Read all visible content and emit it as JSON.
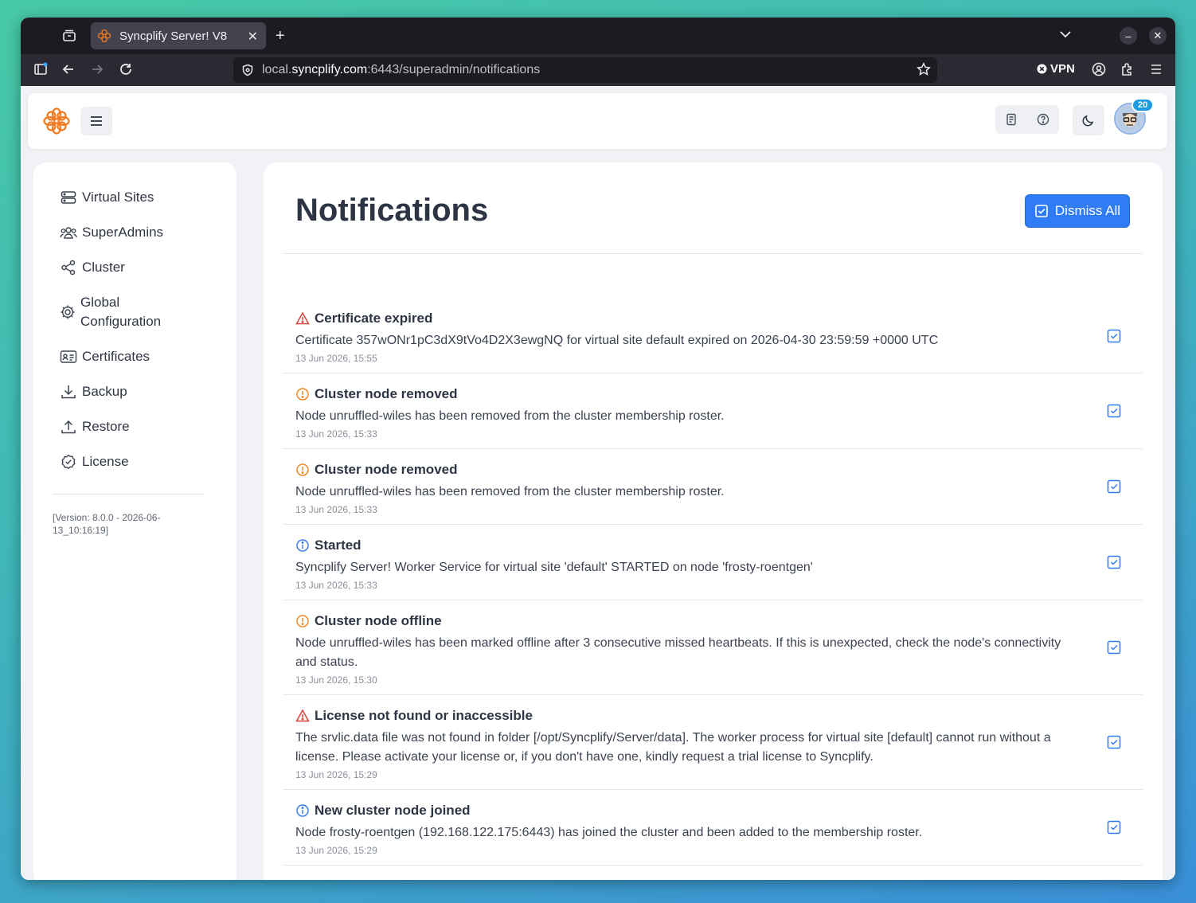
{
  "browser": {
    "tab_title": "Syncplify Server! V8",
    "url_prefix": "local.",
    "url_host": "syncplify.com",
    "url_rest": ":6443/superadmin/notifications",
    "vpn_label": "VPN"
  },
  "header": {
    "notification_count": "20"
  },
  "sidebar": {
    "items": [
      {
        "label": "Virtual Sites",
        "icon": "server-icon"
      },
      {
        "label": "SuperAdmins",
        "icon": "users-icon"
      },
      {
        "label": "Cluster",
        "icon": "share-icon"
      },
      {
        "label": "Global Configuration",
        "icon": "gear-icon"
      },
      {
        "label": "Certificates",
        "icon": "id-card-icon"
      },
      {
        "label": "Backup",
        "icon": "download-icon"
      },
      {
        "label": "Restore",
        "icon": "upload-icon"
      },
      {
        "label": "License",
        "icon": "badge-check-icon"
      }
    ],
    "version": "[Version: 8.0.0 - 2026-06-13_10:16:19]"
  },
  "main": {
    "title": "Notifications",
    "dismiss_all_label": "Dismiss All",
    "notifications": [
      {
        "level": "error",
        "title": "Certificate expired",
        "message": "Certificate 357wONr1pC3dX9tVo4D2X3ewgNQ for virtual site default expired on 2026-04-30 23:59:59 +0000 UTC",
        "time": "13 Jun 2026, 15:55"
      },
      {
        "level": "warning",
        "title": "Cluster node removed",
        "message": "Node unruffled-wiles has been removed from the cluster membership roster.",
        "time": "13 Jun 2026, 15:33"
      },
      {
        "level": "warning",
        "title": "Cluster node removed",
        "message": "Node unruffled-wiles has been removed from the cluster membership roster.",
        "time": "13 Jun 2026, 15:33"
      },
      {
        "level": "info",
        "title": "Started",
        "message": "Syncplify Server! Worker Service for virtual site 'default' STARTED on node 'frosty-roentgen'",
        "time": "13 Jun 2026, 15:33"
      },
      {
        "level": "warning",
        "title": "Cluster node offline",
        "message": "Node unruffled-wiles has been marked offline after 3 consecutive missed heartbeats. If this is unexpected, check the node's connectivity and status.",
        "time": "13 Jun 2026, 15:30"
      },
      {
        "level": "error",
        "title": "License not found or inaccessible",
        "message": "The srvlic.data file was not found in folder [/opt/Syncplify/Server/data]. The worker process for virtual site [default] cannot run without a license. Please activate your license or, if you don't have one, kindly request a trial license to Syncplify.",
        "time": "13 Jun 2026, 15:29"
      },
      {
        "level": "info",
        "title": "New cluster node joined",
        "message": "Node frosty-roentgen (192.168.122.175:6443) has joined the cluster and been added to the membership roster.",
        "time": "13 Jun 2026, 15:29"
      }
    ]
  },
  "colors": {
    "accent": "#2f7cf6",
    "error": "#e0413a",
    "warning": "#ef8a2a",
    "info": "#3b82e6",
    "logo": "#f27a22"
  }
}
